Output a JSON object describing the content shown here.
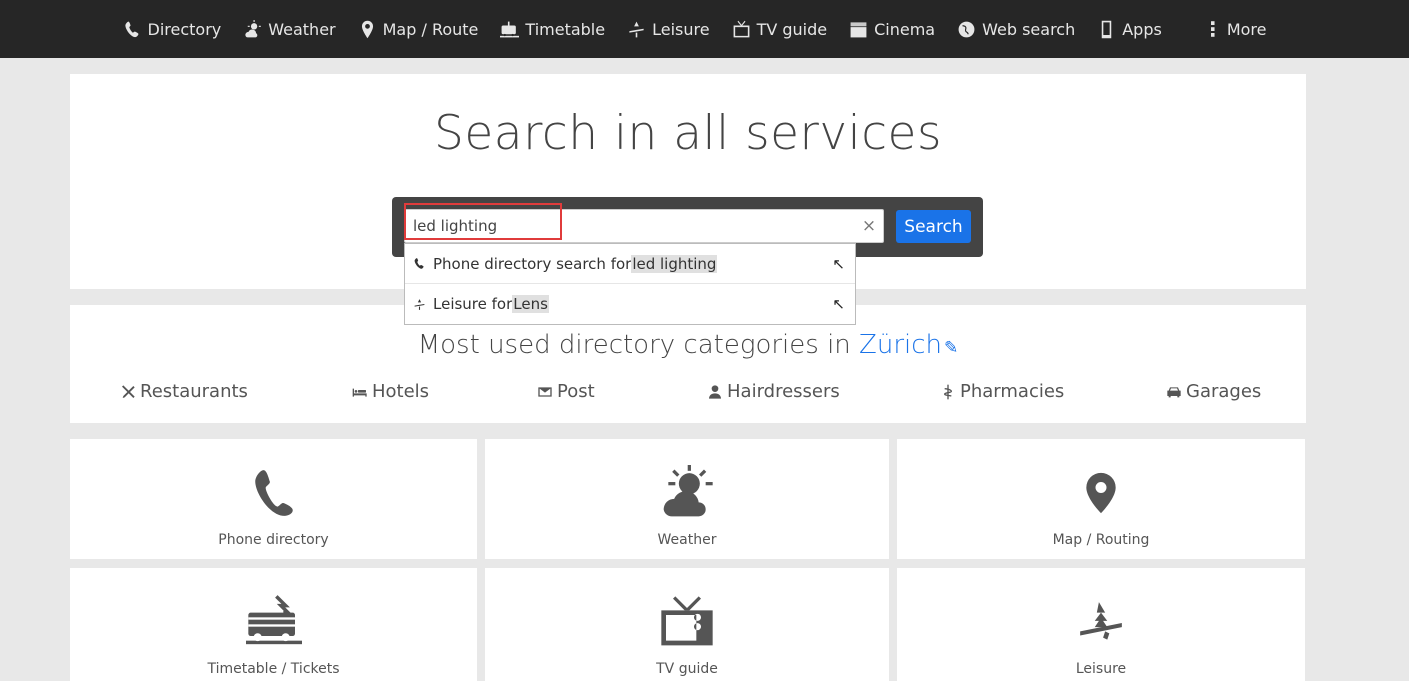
{
  "nav": {
    "items": [
      {
        "label": "Directory",
        "icon": "phone-icon"
      },
      {
        "label": "Weather",
        "icon": "weather-icon"
      },
      {
        "label": "Map / Route",
        "icon": "map-pin-icon"
      },
      {
        "label": "Timetable",
        "icon": "train-icon"
      },
      {
        "label": "Leisure",
        "icon": "leisure-icon"
      },
      {
        "label": "TV guide",
        "icon": "tv-icon"
      },
      {
        "label": "Cinema",
        "icon": "clapperboard-icon"
      },
      {
        "label": "Web search",
        "icon": "globe-icon"
      },
      {
        "label": "Apps",
        "icon": "smartphone-icon"
      },
      {
        "label": "More",
        "icon": "more-vertical-icon"
      }
    ]
  },
  "search": {
    "title": "Search in all services",
    "value": "led lighting",
    "clear_label": "×",
    "button_label": "Search",
    "suggestions": [
      {
        "prefix": "Phone directory search for ",
        "highlight": "led lighting",
        "arrow": "↖"
      },
      {
        "prefix": "Leisure for ",
        "highlight": "Lens",
        "arrow": "↖"
      }
    ]
  },
  "categories": {
    "title_prefix": "Most used directory categories in ",
    "city": "Zürich",
    "edit_icon": "✎",
    "items": [
      {
        "label": "Restaurants",
        "icon": "cutlery-icon"
      },
      {
        "label": "Hotels",
        "icon": "bed-icon"
      },
      {
        "label": "Post",
        "icon": "envelope-icon"
      },
      {
        "label": "Hairdressers",
        "icon": "person-icon"
      },
      {
        "label": "Pharmacies",
        "icon": "caduceus-icon"
      },
      {
        "label": "Garages",
        "icon": "car-icon"
      }
    ]
  },
  "tiles": [
    {
      "label": "Phone directory",
      "icon": "phone-icon"
    },
    {
      "label": "Weather",
      "icon": "weather-icon"
    },
    {
      "label": "Map / Routing",
      "icon": "map-pin-icon"
    },
    {
      "label": "Timetable / Tickets",
      "icon": "train-icon"
    },
    {
      "label": "TV guide",
      "icon": "tv-icon"
    },
    {
      "label": "Leisure",
      "icon": "leisure-icon"
    }
  ],
  "colors": {
    "nav_bg": "#262626",
    "accent": "#1a73e8",
    "highlight_border": "#e03b3b"
  }
}
